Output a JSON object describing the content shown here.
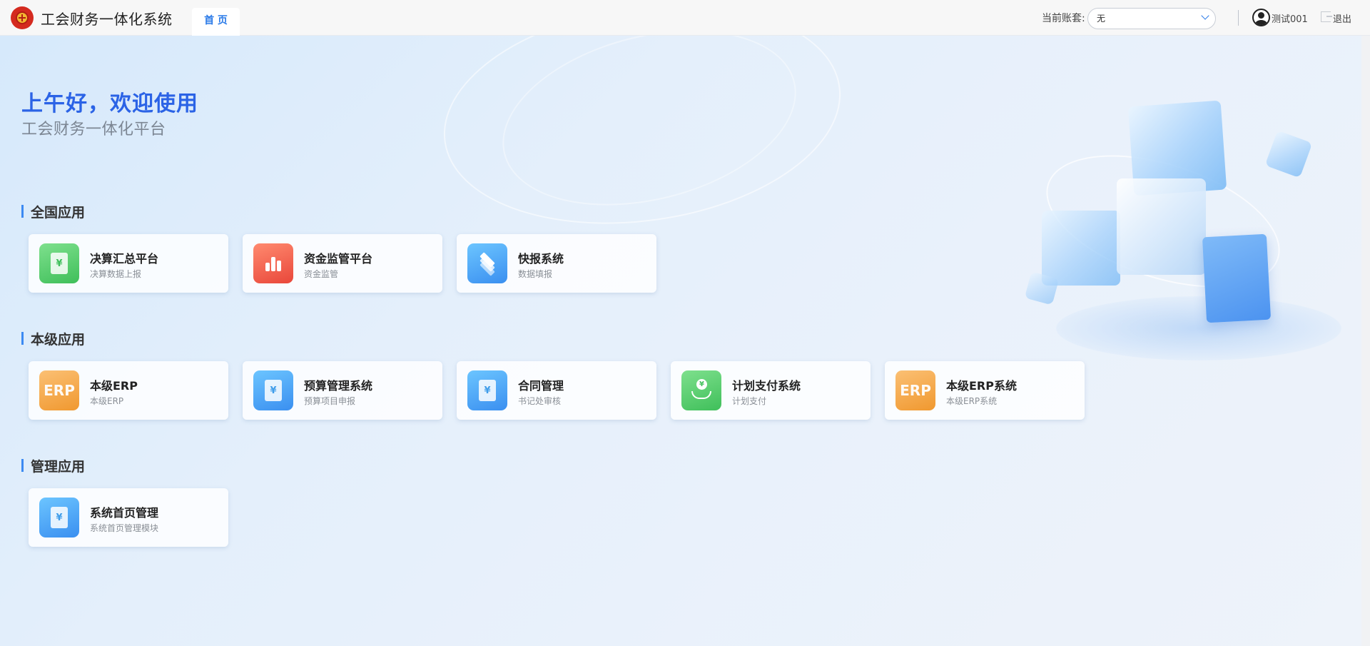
{
  "header": {
    "app_title": "工会财务一体化系统",
    "tab_home": "首 页",
    "account_label": "当前账套:",
    "account_value": "无",
    "user_name": "测试001",
    "logout_label": "退出"
  },
  "hero": {
    "greeting": "上午好，欢迎使用",
    "subtitle": "工会财务一体化平台"
  },
  "sections": [
    {
      "title": "全国应用",
      "apps": [
        {
          "name": "决算汇总平台",
          "desc": "决算数据上报",
          "icon": "ledger-yen-icon",
          "color": "#4cc766"
        },
        {
          "name": "资金监管平台",
          "desc": "资金监管",
          "icon": "bar-chart-icon",
          "color": "#ee5a45"
        },
        {
          "name": "快报系统",
          "desc": "数据填报",
          "icon": "layers-icon",
          "color": "#4aa5f5"
        }
      ]
    },
    {
      "title": "本级应用",
      "apps": [
        {
          "name": "本级ERP",
          "desc": "本级ERP",
          "icon": "erp-icon",
          "icon_text": "ERP",
          "color": "#f3a640"
        },
        {
          "name": "预算管理系统",
          "desc": "预算项目申报",
          "icon": "budget-doc-icon",
          "color": "#4aa5f5"
        },
        {
          "name": "合同管理",
          "desc": "书记处审核",
          "icon": "contract-doc-icon",
          "color": "#4aa5f5"
        },
        {
          "name": "计划支付系统",
          "desc": "计划支付",
          "icon": "hand-coin-icon",
          "color": "#4cc766"
        },
        {
          "name": "本级ERP系统",
          "desc": "本级ERP系统",
          "icon": "erp-icon",
          "icon_text": "ERP",
          "color": "#f3a640"
        }
      ]
    },
    {
      "title": "管理应用",
      "apps": [
        {
          "name": "系统首页管理",
          "desc": "系统首页管理模块",
          "icon": "home-doc-icon",
          "color": "#4aa5f5"
        }
      ]
    }
  ]
}
